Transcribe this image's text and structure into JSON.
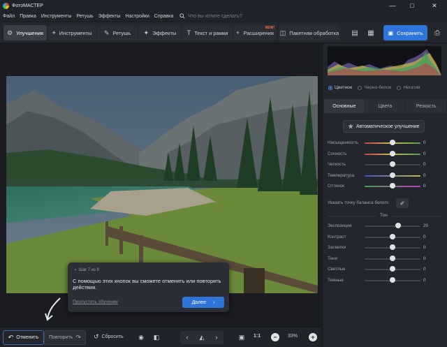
{
  "window": {
    "title": "ФотоМАСТЕР",
    "controls": [
      "minimize",
      "maximize",
      "close"
    ]
  },
  "menu": {
    "items": [
      "Файл",
      "Правка",
      "Инструменты",
      "Ретушь",
      "Эффекты",
      "Настройки",
      "Справка"
    ],
    "search_placeholder": "Что вы хотите сделать?"
  },
  "toolbar": {
    "tabs": [
      {
        "label": "Улучшения",
        "icon": "enhance-icon",
        "active": true
      },
      {
        "label": "Инструменты",
        "icon": "crop-icon"
      },
      {
        "label": "Ретушь",
        "icon": "brush-icon"
      },
      {
        "label": "Эффекты",
        "icon": "wand-icon"
      },
      {
        "label": "Текст и рамки",
        "icon": "text-icon"
      },
      {
        "label": "Расширения",
        "icon": "plus-icon",
        "badge": "NEW!"
      },
      {
        "label": "Пакетная обработка",
        "icon": "batch-icon"
      }
    ],
    "save_label": "Сохранить"
  },
  "tooltip": {
    "step_prefix": "Шаг",
    "step_current": "7",
    "step_sep": "из",
    "step_total": "8",
    "text": "С помощью этих кнопок вы сможете отменять или повторять действия.",
    "skip_label": "Пропустить обучение",
    "next_label": "Далее"
  },
  "bottombar": {
    "undo_label": "Отменить",
    "redo_label": "Повторить",
    "reset_label": "Сбросить",
    "ratio_label": "1:1",
    "zoom": "33%"
  },
  "panel": {
    "modes": [
      {
        "label": "Цветное",
        "selected": true
      },
      {
        "label": "Черно-белое",
        "selected": false
      },
      {
        "label": "Негатив",
        "selected": false
      }
    ],
    "tabs": [
      {
        "label": "Основные",
        "active": true
      },
      {
        "label": "Цвета",
        "active": false
      },
      {
        "label": "Резкость",
        "active": false
      }
    ],
    "auto_label": "Автоматическое улучшение",
    "color_sliders": [
      {
        "label": "Насыщенность",
        "value": "0",
        "level": 0.5
      },
      {
        "label": "Сочность",
        "value": "0",
        "level": 0.5
      },
      {
        "label": "Четкость",
        "value": "0",
        "level": 0.5
      },
      {
        "label": "Температура",
        "value": "0",
        "level": 0.5
      },
      {
        "label": "Оттенок",
        "value": "0",
        "level": 0.5
      }
    ],
    "wb_label": "Указать точку баланса белого",
    "tone_title": "Тон",
    "tone_sliders": [
      {
        "label": "Экспозиция",
        "value": "20",
        "level": 0.6
      },
      {
        "label": "Контраст",
        "value": "0",
        "level": 0.5
      },
      {
        "label": "Засветки",
        "value": "0",
        "level": 0.5
      },
      {
        "label": "Тени",
        "value": "0",
        "level": 0.5
      },
      {
        "label": "Светлые",
        "value": "0",
        "level": 0.5
      },
      {
        "label": "Темные",
        "value": "0",
        "level": 0.5
      }
    ]
  },
  "colors": {
    "accent": "#2f74d8",
    "saturation_gradient": [
      "#c94040",
      "#c9c040",
      "#4aa050"
    ],
    "temperature_gradient": [
      "#4050c9",
      "#c9c040"
    ],
    "tint_gradient": [
      "#40a050",
      "#c040c0"
    ]
  }
}
